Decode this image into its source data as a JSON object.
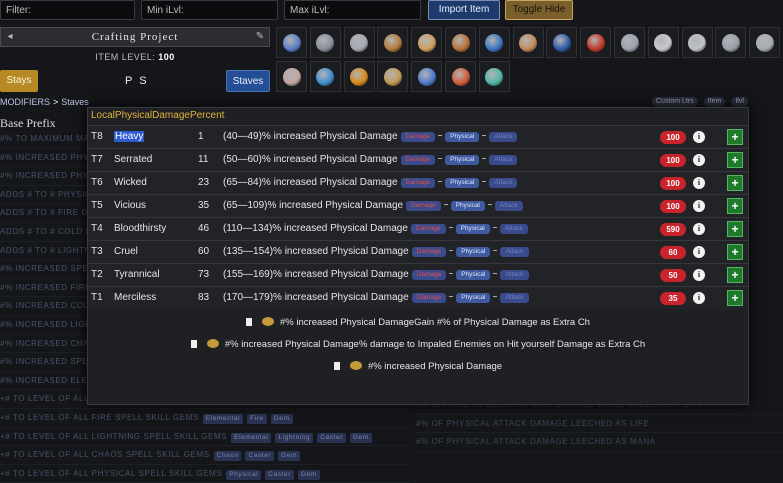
{
  "topbar": {
    "filter_placeholder": "Filter:",
    "min_ilvl_placeholder": "Min iLvl:",
    "max_ilvl_placeholder": "Max iLvl:",
    "import_label": "Import Item",
    "toggle_label": "Toggle Hide"
  },
  "left": {
    "crafting_title": "Crafting Project",
    "item_level_label": "ITEM LEVEL:",
    "item_level_value": "100",
    "stays_label": "Stays",
    "ps_label": "P S",
    "staves_label": "Staves",
    "breadcrumb": [
      "MODIFIERS",
      "Staves"
    ],
    "base_prefix": "Base Prefix"
  },
  "top_right_tags": [
    "Custom Ltrs",
    "Item",
    "Ilvl"
  ],
  "background_rows": [
    {
      "text": "#% TO MAXIMUM MANA",
      "tags": []
    },
    {
      "text": "#% INCREASED PHYSICAL DAMAGE",
      "tags": []
    },
    {
      "text": "#% INCREASED PHYSICAL DAMAGE",
      "tags": []
    },
    {
      "text": "ADDS # TO # PHYSICAL DAMAGE",
      "tags": []
    },
    {
      "text": "ADDS # TO # FIRE DAMAGE",
      "tags": []
    },
    {
      "text": "ADDS # TO # COLD DAMAGE",
      "tags": []
    },
    {
      "text": "ADDS # TO # LIGHTNING DAMAGE",
      "tags": []
    },
    {
      "text": "#% INCREASED SPELL DAMAGE",
      "tags": []
    },
    {
      "text": "#% INCREASED FIRE DAMAGE",
      "tags": []
    },
    {
      "text": "#% INCREASED COLD DAMAGE",
      "tags": []
    },
    {
      "text": "#% INCREASED LIGHTNING DAMAGE",
      "tags": []
    },
    {
      "text": "#% INCREASED CHAOS DAMAGE",
      "tags": []
    },
    {
      "text": "#% INCREASED SPELL DAMAGE",
      "tags": []
    },
    {
      "text": "#% INCREASED ELEMENTAL DAMAGE",
      "tags": []
    },
    {
      "text": "+# TO LEVEL OF ALL SPELL SKILL GEMS",
      "tags": []
    },
    {
      "text": "+# TO LEVEL OF ALL FIRE SPELL SKILL GEMS",
      "tags": [
        "Elemental",
        "Fire",
        "Gem"
      ]
    },
    {
      "text": "+# TO LEVEL OF ALL LIGHTNING SPELL SKILL GEMS",
      "tags": [
        "Elemental",
        "Lightning",
        "Caster",
        "Gem"
      ]
    },
    {
      "text": "+# TO LEVEL OF ALL CHAOS SPELL SKILL GEMS",
      "tags": [
        "Chaos",
        "Caster",
        "Gem"
      ]
    },
    {
      "text": "+# TO LEVEL OF ALL PHYSICAL SPELL SKILL GEMS",
      "tags": [
        "Physical",
        "Caster",
        "Gem"
      ]
    }
  ],
  "right_background_rows": [
    "#% CHANCE TO BLOCK ATTACK DAMAGE WHILE WIELDING A STAFF",
    "#% OF PHYSICAL ATTACK DAMAGE LEECHED AS LIFE",
    "#% OF PHYSICAL ATTACK DAMAGE LEECHED AS MANA"
  ],
  "modal": {
    "title": "LocalPhysicalDamagePercent",
    "mod_text": "increased Physical Damage",
    "tag_damage": "Damage",
    "tag_physical": "Physical",
    "tag_attack": "Attack",
    "info_glyph": "i",
    "add_glyph": "+",
    "rows": [
      {
        "tier": "T8",
        "name": "Heavy",
        "level": "1",
        "range": "(40—49)%",
        "weight": "100",
        "selected": true
      },
      {
        "tier": "T7",
        "name": "Serrated",
        "level": "11",
        "range": "(50—60)%",
        "weight": "100"
      },
      {
        "tier": "T6",
        "name": "Wicked",
        "level": "23",
        "range": "(65—84)%",
        "weight": "100"
      },
      {
        "tier": "T5",
        "name": "Vicious",
        "level": "35",
        "range": "(65—109)%",
        "weight": "100"
      },
      {
        "tier": "T4",
        "name": "Bloodthirsty",
        "level": "46",
        "range": "(110—134)%",
        "weight": "590"
      },
      {
        "tier": "T3",
        "name": "Cruel",
        "level": "60",
        "range": "(135—154)%",
        "weight": "60"
      },
      {
        "tier": "T2",
        "name": "Tyrannical",
        "level": "73",
        "range": "(155—169)%",
        "weight": "50"
      },
      {
        "tier": "T1",
        "name": "Merciless",
        "level": "83",
        "range": "(170—179)%",
        "weight": "35"
      }
    ],
    "hybrids": [
      "#% increased Physical DamageGain #% of Physical Damage as Extra Ch",
      "#% increased Physical Damage% damage to Impaled Enemies on Hit yourself Damage as Extra Ch",
      "#% increased Physical Damage"
    ]
  },
  "icons": [
    "ice-shard-icon",
    "sphere-icon",
    "helmet-icon",
    "horn-icon",
    "shield-grid-icon",
    "fist-icon",
    "cube-icon",
    "gauntlet-icon",
    "raven-icon",
    "flame-orb-icon",
    "wolf-icon",
    "claw-icon",
    "slash-icon",
    "sword-icon",
    "ring-icon",
    "hound-icon",
    "ice-crystal-icon",
    "eye-icon",
    "hammer-icon",
    "gem-icon",
    "spark-icon",
    "serpent-icon"
  ],
  "icon_colors": [
    "#5b7fc8",
    "#8a8f9e",
    "#a7a9b3",
    "#b47a3a",
    "#d1a15e",
    "#b9733a",
    "#3b76c4",
    "#c48c5a",
    "#2e5da8",
    "#c03a25",
    "#9aa2b0",
    "#c7c9d0",
    "#bfc2c8",
    "#9aa0ab",
    "#a8abb5",
    "#c2a5a0",
    "#3f8fd0",
    "#d88a1a",
    "#c29a55",
    "#4f7cd0",
    "#d45b3a",
    "#4fb7a7"
  ]
}
